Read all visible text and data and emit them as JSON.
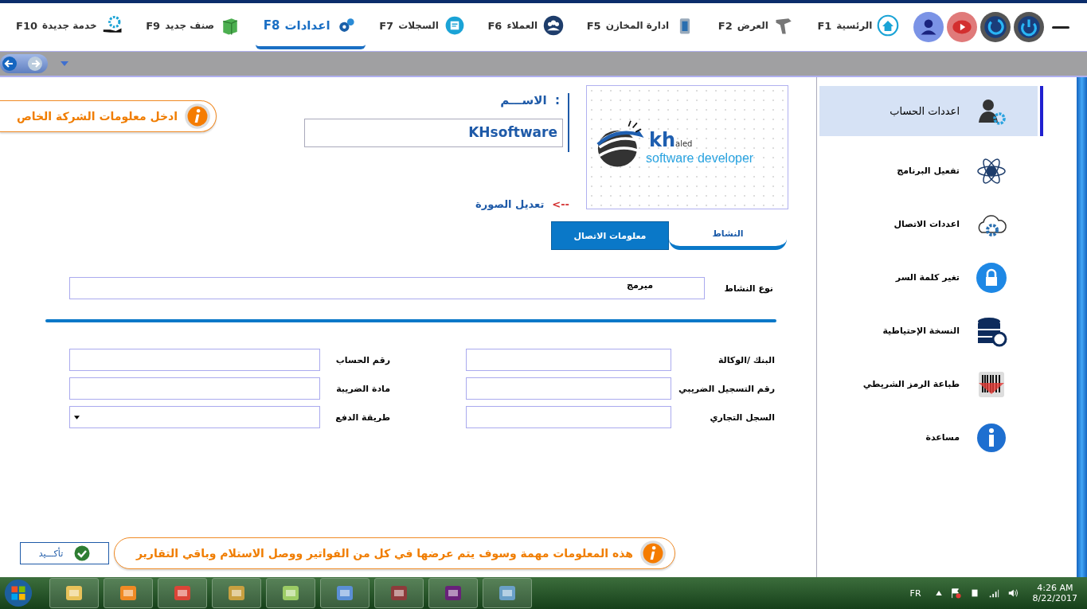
{
  "top_menu": {
    "items": [
      {
        "label": "الرئسية",
        "key": "F1",
        "selected": false
      },
      {
        "label": "العرض",
        "key": "F2",
        "selected": false
      },
      {
        "label": "ادارة المخازن",
        "key": "F5",
        "selected": false
      },
      {
        "label": "العملاء",
        "key": "F6",
        "selected": false
      },
      {
        "label": "السجلات",
        "key": "F7",
        "selected": false
      },
      {
        "label": "اعدادات",
        "key": "F8",
        "selected": true
      },
      {
        "label": "صنف جديد",
        "key": "F9",
        "selected": false
      },
      {
        "label": "خدمة جديدة",
        "key": "F10",
        "selected": false
      }
    ]
  },
  "company_hint": "ادخل معلومات الشركة الخاص",
  "name_field": {
    "label": "الاســـم  :",
    "value": "KHsoftware"
  },
  "logo": {
    "mark": "kh",
    "suffix": "aled",
    "tagline": "software developer"
  },
  "edit_image": {
    "arrow": "<--",
    "label": "تعديل الصورة"
  },
  "tabs": [
    {
      "label": "النشاط",
      "selected": true
    },
    {
      "label": "معلومات الاتصال",
      "selected": false
    }
  ],
  "activity": {
    "label": "نوع النشاط",
    "value": "ميرمج"
  },
  "fields": [
    {
      "label": "البنك /الوكالة",
      "kind": "text"
    },
    {
      "label": "رقم الحساب",
      "kind": "text"
    },
    {
      "label": "رقم التسجيل الضريبي",
      "kind": "text"
    },
    {
      "label": "مادة الضريبة",
      "kind": "text"
    },
    {
      "label": "السجل التجاري",
      "kind": "text"
    },
    {
      "label": "طريقة الدفع",
      "kind": "dropdown"
    }
  ],
  "confirm_button": "تأكـــيد",
  "footer_note": "هذه المعلومات مهمة وسوف يتم عرضها في كل من الفواتير ووصل الاستلام وباقي التقارير",
  "sidebar": {
    "items": [
      {
        "label": "اعددات الحساب",
        "selected": true
      },
      {
        "label": "تفعيل البرنامج",
        "selected": false
      },
      {
        "label": "اعددات الاتصال",
        "selected": false
      },
      {
        "label": "تغير كلمة السر",
        "selected": false
      },
      {
        "label": "النسخة الإحتياطية",
        "selected": false
      },
      {
        "label": "طباعة الرمز الشريطي",
        "selected": false
      },
      {
        "label": "مساعدة",
        "selected": false
      }
    ]
  },
  "taskbar": {
    "language": "FR",
    "time": "4:26 AM",
    "date": "8/22/2017"
  }
}
